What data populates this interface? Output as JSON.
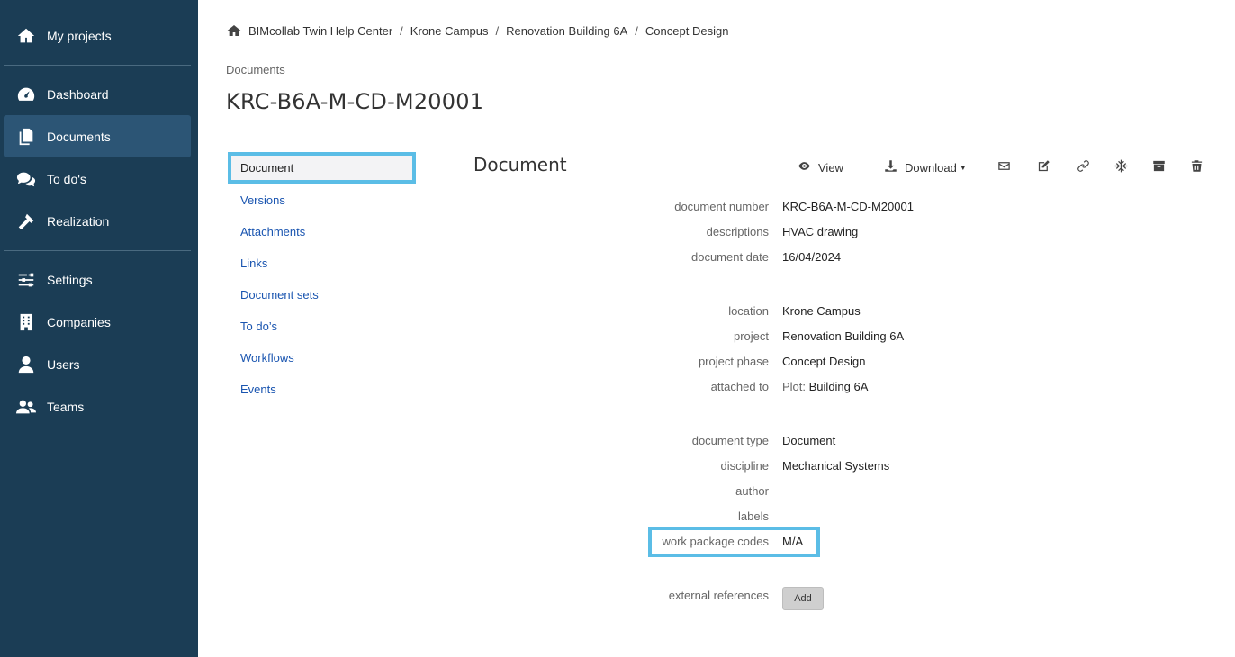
{
  "sidebar": {
    "items": [
      {
        "label": "My projects",
        "icon": "home-icon"
      },
      {
        "label": "Dashboard",
        "icon": "dashboard-icon"
      },
      {
        "label": "Documents",
        "icon": "documents-icon"
      },
      {
        "label": "To do's",
        "icon": "comments-icon"
      },
      {
        "label": "Realization",
        "icon": "hammer-icon"
      },
      {
        "label": "Settings",
        "icon": "sliders-icon"
      },
      {
        "label": "Companies",
        "icon": "building-icon"
      },
      {
        "label": "Users",
        "icon": "user-icon"
      },
      {
        "label": "Teams",
        "icon": "users-icon"
      }
    ],
    "active": "Documents",
    "colors": {
      "background": "#1b3d55",
      "active": "#2c5575"
    }
  },
  "breadcrumb": [
    "BIMcollab Twin Help Center",
    "Krone Campus",
    "Renovation Building 6A",
    "Concept Design"
  ],
  "breadcrumb_separator": "/",
  "section_label": "Documents",
  "page_title": "KRC-B6A-M-CD-M20001",
  "subnav": {
    "items": [
      "Document",
      "Versions",
      "Attachments",
      "Links",
      "Document sets",
      "To do’s",
      "Workflows",
      "Events"
    ],
    "active": "Document",
    "highlight_color": "#5bbde6",
    "link_color": "#1a55b0"
  },
  "panel": {
    "title": "Document",
    "toolbar": {
      "view_label": "View",
      "download_label": "Download",
      "icons": [
        "eye-icon",
        "download-icon",
        "envelope-icon",
        "edit-icon",
        "link-icon",
        "snowflake-icon",
        "archive-icon",
        "trash-icon"
      ]
    },
    "fields": {
      "document_number": {
        "label": "document number",
        "value": "KRC-B6A-M-CD-M20001"
      },
      "descriptions": {
        "label": "descriptions",
        "value": "HVAC drawing"
      },
      "document_date": {
        "label": "document date",
        "value": "16/04/2024"
      },
      "location": {
        "label": "location",
        "value": "Krone Campus"
      },
      "project": {
        "label": "project",
        "value": "Renovation Building 6A"
      },
      "project_phase": {
        "label": "project phase",
        "value": "Concept Design"
      },
      "attached_to": {
        "label": "attached to",
        "prefix": "Plot:",
        "value": "Building 6A"
      },
      "document_type": {
        "label": "document type",
        "value": "Document"
      },
      "discipline": {
        "label": "discipline",
        "value": "Mechanical Systems"
      },
      "author": {
        "label": "author",
        "value": ""
      },
      "labels": {
        "label": "labels",
        "value": ""
      },
      "work_package_codes": {
        "label": "work package codes",
        "value": "M/A"
      },
      "external_references": {
        "label": "external references",
        "button": "Add"
      }
    }
  }
}
